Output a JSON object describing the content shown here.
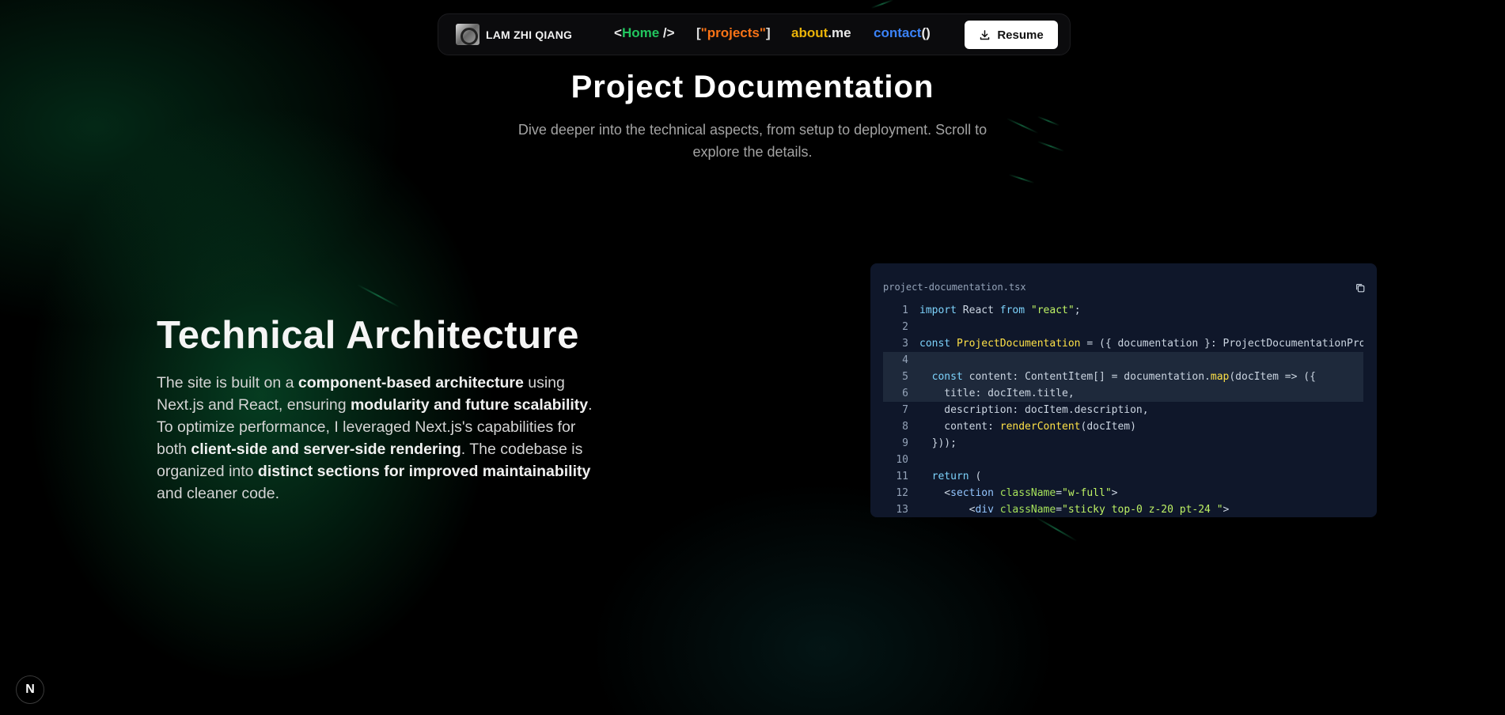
{
  "nav": {
    "brand": "LAM ZHI QIANG",
    "home": {
      "pre": "<",
      "word": "Home",
      "post": " />"
    },
    "projects": {
      "pre": "[",
      "word": "\"projects\"",
      "post": "]"
    },
    "about": {
      "word": "about",
      "post": ".me"
    },
    "contact": {
      "word": "contact",
      "post": "()"
    },
    "resume_label": "Resume"
  },
  "header": {
    "title": "Project Documentation",
    "subtitle": "Dive deeper into the technical aspects, from setup to deployment. Scroll to explore the details."
  },
  "section": {
    "title": "Technical Architecture",
    "body": [
      {
        "t": "The site is built on a ",
        "b": false
      },
      {
        "t": "component-based architecture",
        "b": true
      },
      {
        "t": " using Next.js and React, ensuring ",
        "b": false
      },
      {
        "t": "modularity and future scalability",
        "b": true
      },
      {
        "t": ". To optimize performance, I leveraged Next.js's capabilities for both ",
        "b": false
      },
      {
        "t": "client-side and server-side rendering",
        "b": true
      },
      {
        "t": ". The codebase is organized into ",
        "b": false
      },
      {
        "t": "distinct sections for improved maintainability",
        "b": true
      },
      {
        "t": " and cleaner code.",
        "b": false
      }
    ]
  },
  "code": {
    "filename": "project-documentation.tsx",
    "highlighted_lines": [
      4,
      5,
      6
    ],
    "lines": [
      [
        [
          "kw",
          "import"
        ],
        [
          "",
          " React "
        ],
        [
          "kw",
          "from"
        ],
        [
          "",
          " "
        ],
        [
          "str",
          "\"react\""
        ],
        [
          "",
          ";"
        ]
      ],
      [],
      [
        [
          "kw",
          "const"
        ],
        [
          "",
          " "
        ],
        [
          "fn",
          "ProjectDocumentation"
        ],
        [
          "",
          " = ({ documentation }: ProjectDocumentationProp"
        ]
      ],
      [],
      [
        [
          "",
          "  "
        ],
        [
          "kw",
          "const"
        ],
        [
          "",
          " content: ContentItem[] = documentation."
        ],
        [
          "fn",
          "map"
        ],
        [
          "",
          "(docItem => ({"
        ]
      ],
      [
        [
          "",
          "    title: docItem.title,"
        ]
      ],
      [
        [
          "",
          "    description: docItem.description,"
        ]
      ],
      [
        [
          "",
          "    content: "
        ],
        [
          "fn",
          "renderContent"
        ],
        [
          "",
          "(docItem)"
        ]
      ],
      [
        [
          "",
          "  }));"
        ]
      ],
      [],
      [
        [
          "",
          "  "
        ],
        [
          "kw",
          "return"
        ],
        [
          "",
          " ("
        ]
      ],
      [
        [
          "",
          "    <"
        ],
        [
          "tag",
          "section"
        ],
        [
          "",
          " "
        ],
        [
          "attr",
          "className"
        ],
        [
          "",
          "="
        ],
        [
          "str",
          "\"w-full\""
        ],
        [
          "",
          ">"
        ]
      ],
      [
        [
          "",
          "        <"
        ],
        [
          "tag",
          "div"
        ],
        [
          "",
          " "
        ],
        [
          "attr",
          "className"
        ],
        [
          "",
          "="
        ],
        [
          "str",
          "\"sticky top-0 z-20 pt-24 \""
        ],
        [
          "",
          ">"
        ]
      ]
    ]
  },
  "badge": {
    "label": "N"
  }
}
